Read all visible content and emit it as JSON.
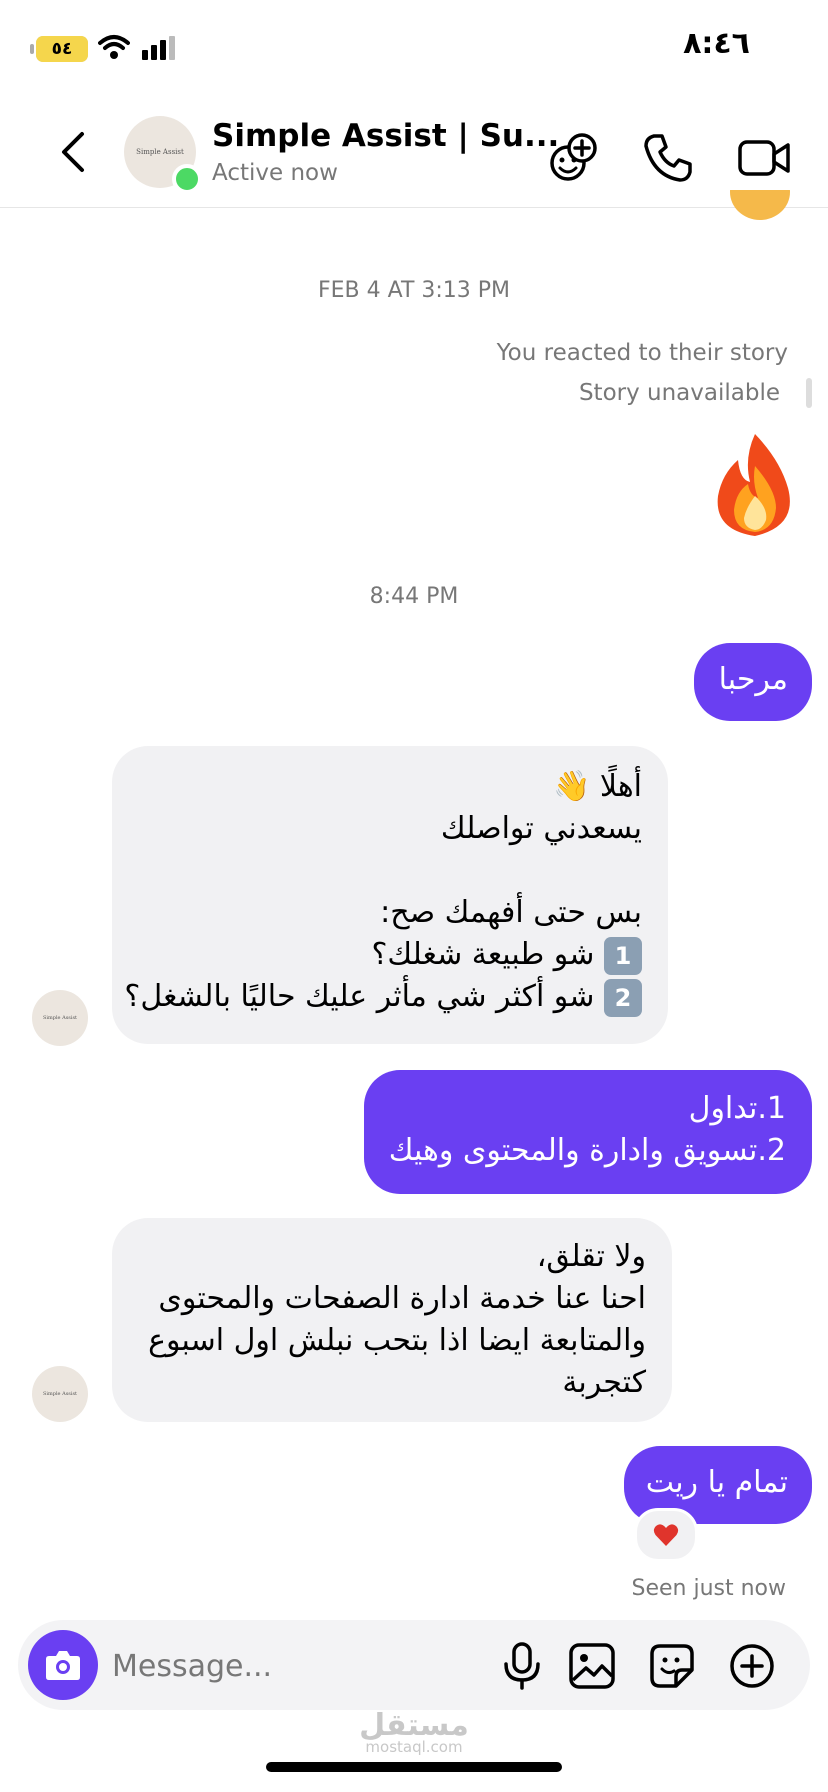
{
  "status_bar": {
    "time": "٨:٤٦",
    "battery": "٥٤"
  },
  "header": {
    "contact_name": "Simple Assist | Su...",
    "status": "Active now",
    "avatar_text": "Simple Assist",
    "icons": [
      "back-chevron-icon",
      "add-people-icon",
      "phone-icon",
      "video-camera-icon"
    ]
  },
  "thread": {
    "timestamp1": "FEB 4 AT 3:13 PM",
    "story_reaction": "You reacted to their story",
    "story_unavailable": "Story unavailable",
    "timestamp2": "8:44 PM",
    "avatar_text": "Simple Assist",
    "messages": [
      {
        "from": "me",
        "lines": [
          "مرحبا"
        ]
      },
      {
        "from": "them",
        "lines": [
          "أهلًا 👋",
          "يسعدني تواصلك",
          "",
          "بس حتى أفهمك صح:",
          "شو طبيعة شغلك؟",
          "شو أكثر شي مأثر عليك حاليًا بالشغل؟"
        ],
        "keycaps": [
          "1",
          "2"
        ]
      },
      {
        "from": "me",
        "lines": [
          "1.تداول",
          "2.تسويق وادارة والمحتوى وهيك"
        ]
      },
      {
        "from": "them",
        "lines": [
          "ولا تقلق،",
          "احنا عنا خدمة ادارة الصفحات والمحتوى",
          "والمتابعة ايضا اذا بتحب نبلش اول اسبوع",
          "كتجربة"
        ]
      },
      {
        "from": "me",
        "lines": [
          "تمام يا ريت"
        ]
      }
    ],
    "reaction": "heart",
    "seen": "Seen just now"
  },
  "composer": {
    "placeholder": "Message...",
    "icons": [
      "camera-icon",
      "microphone-icon",
      "gallery-icon",
      "sticker-icon",
      "plus-icon"
    ]
  },
  "watermark": {
    "text": "مستقل",
    "sub": "mostaql.com"
  },
  "colors": {
    "outgoing_bubble": "#6a3ff2",
    "incoming_bubble": "#f1f1f3",
    "online": "#4cd964"
  }
}
